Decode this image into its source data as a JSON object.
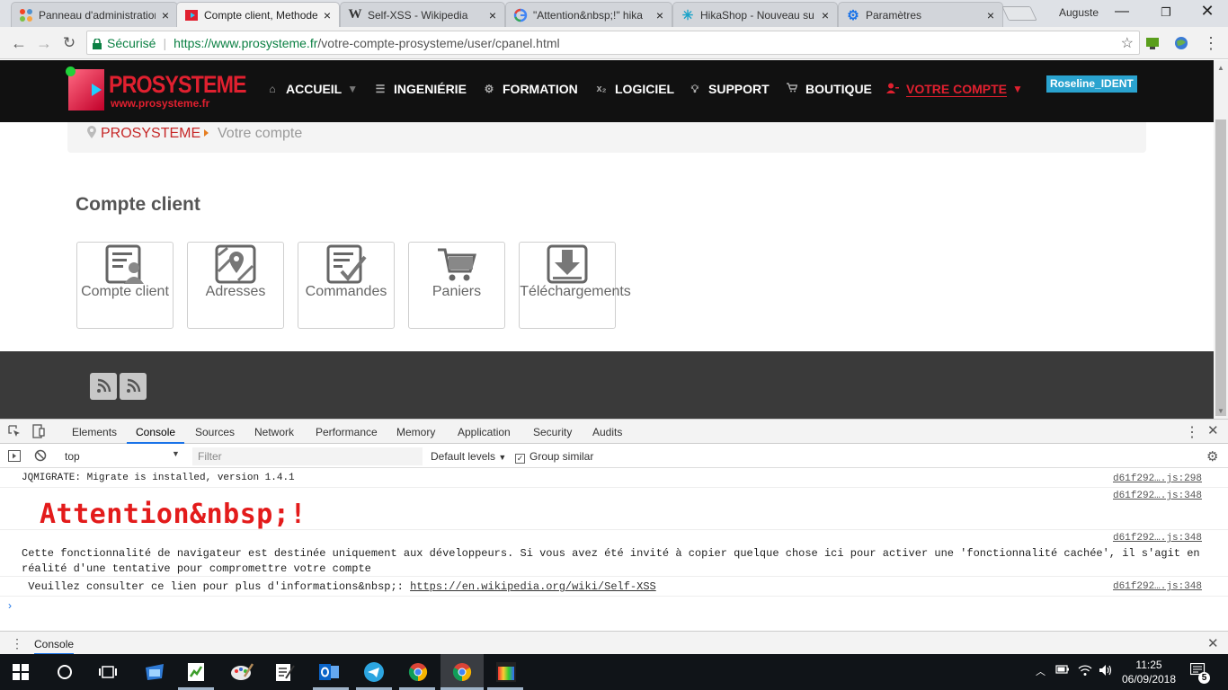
{
  "browser": {
    "tabs": [
      {
        "title": "Panneau d'administration",
        "favicon": "joomla-icon",
        "active": false
      },
      {
        "title": "Compte client, Methode",
        "favicon": "prosysteme-icon",
        "active": true
      },
      {
        "title": "Self-XSS - Wikipedia",
        "favicon": "wikipedia-icon",
        "active": false
      },
      {
        "title": "\"Attention&nbsp;!\" hika",
        "favicon": "google-icon",
        "active": false
      },
      {
        "title": "HikaShop - Nouveau su",
        "favicon": "hikashop-icon",
        "active": false
      },
      {
        "title": "Paramètres",
        "favicon": "settings-gear-icon",
        "active": false
      }
    ],
    "profile_name": "Auguste",
    "address": {
      "secure_label": "Sécurisé",
      "host": "https://www.prosysteme.fr",
      "path": "/votre-compte-prosysteme/user/cpanel.html"
    }
  },
  "site": {
    "logo": {
      "brand": "PROSYSTEME",
      "url": "www.prosysteme.fr"
    },
    "menu": [
      {
        "label": "ACCUEIL",
        "icon": "home-icon",
        "dropdown": true
      },
      {
        "label": "INGENIÉRIE",
        "icon": "list-icon",
        "dropdown": false
      },
      {
        "label": "FORMATION",
        "icon": "cogs-icon",
        "dropdown": false
      },
      {
        "label": "LOGICIEL",
        "icon": "subscript-icon",
        "dropdown": false
      },
      {
        "label": "SUPPORT",
        "icon": "lightbulb-icon",
        "dropdown": false
      },
      {
        "label": "BOUTIQUE",
        "icon": "cart-icon",
        "dropdown": false
      },
      {
        "label": "VOTRE COMPTE",
        "icon": "user-icon",
        "dropdown": true,
        "active": true
      }
    ],
    "user_badge": "Roseline_IDENT",
    "breadcrumb": {
      "home": "PROSYSTEME",
      "current": "Votre compte"
    },
    "page_title": "Compte client",
    "tiles": [
      {
        "label": "Compte client",
        "icon": "customer-account-icon"
      },
      {
        "label": "Adresses",
        "icon": "map-pin-icon"
      },
      {
        "label": "Commandes",
        "icon": "orders-checklist-icon"
      },
      {
        "label": "Paniers",
        "icon": "shopping-cart-icon"
      },
      {
        "label": "Téléchargements",
        "icon": "download-icon"
      }
    ],
    "footer_icons": [
      "rss-icon",
      "rss-icon"
    ],
    "colors": {
      "brand_red": "#e0202f",
      "header_bg": "#111111",
      "footer_bg": "#3a3a3a",
      "badge": "#2aa3cf"
    }
  },
  "devtools": {
    "tabs": [
      "Elements",
      "Console",
      "Sources",
      "Network",
      "Performance",
      "Memory",
      "Application",
      "Security",
      "Audits"
    ],
    "active_tab": "Console",
    "context": "top",
    "filter_placeholder": "Filter",
    "levels": "Default levels",
    "group_similar": {
      "label": "Group similar",
      "checked": true
    },
    "console": [
      {
        "text": "JQMIGRATE: Migrate is installed, version 1.4.1",
        "source": "d61f292….js:298"
      },
      {
        "text": "Attention&nbsp;!",
        "source": "d61f292….js:348"
      },
      {
        "text": " Cette fonctionnalité de navigateur est destinée uniquement aux développeurs. Si vous avez été invité à copier quelque chose ici pour activer une 'fonctionnalité cachée', il s'agit en réalité d'une tentative pour compromettre votre compte",
        "source": "d61f292….js:348"
      },
      {
        "text": " Veuillez consulter ce lien pour plus d'informations&nbsp;: ",
        "link": "https://en.wikipedia.org/wiki/Self-XSS",
        "source": "d61f292….js:348"
      }
    ],
    "drawer_tab": "Console"
  },
  "taskbar": {
    "time": "11:25",
    "date": "06/09/2018",
    "notifications": "5"
  }
}
